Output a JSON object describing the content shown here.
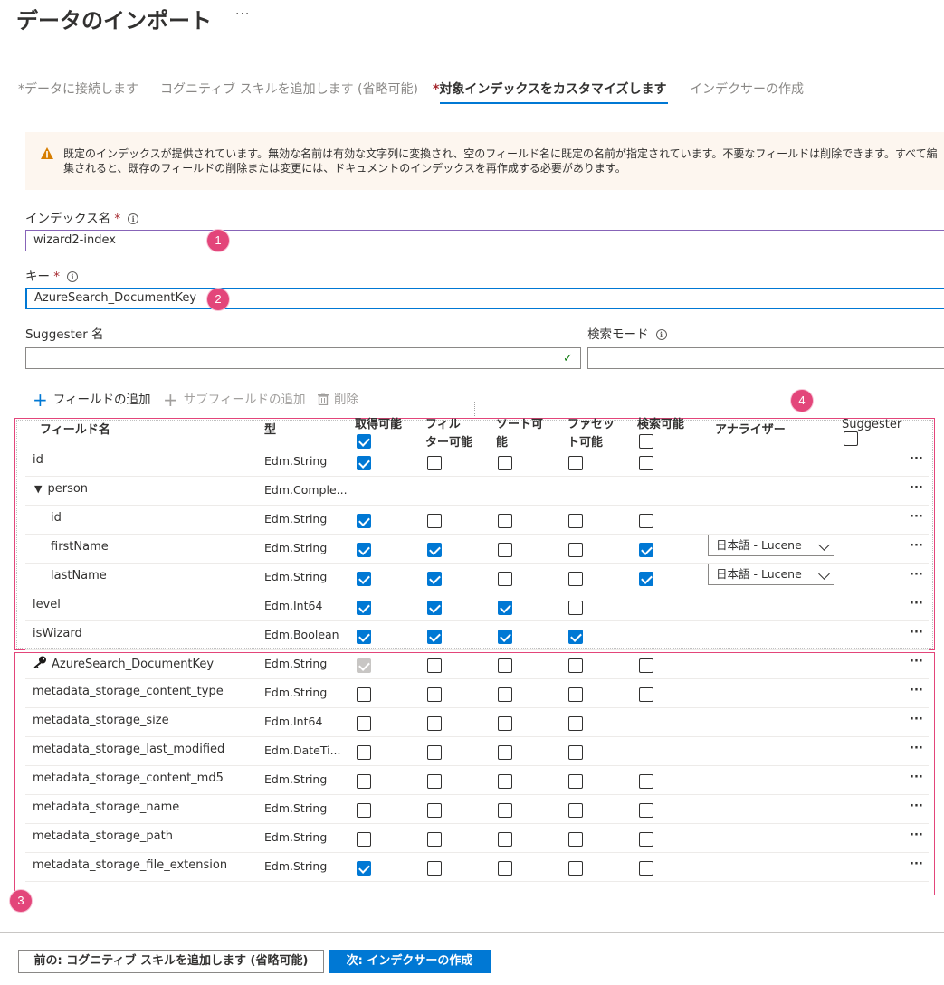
{
  "header": {
    "title": "データのインポート",
    "more_label": "···"
  },
  "steps": [
    {
      "marker": "*",
      "label": "データに接続します",
      "state": "done"
    },
    {
      "marker": "",
      "label": "コグニティブ スキルを追加します (省略可能)",
      "state": "done"
    },
    {
      "marker": "*",
      "label": "対象インデックスをカスタマイズします",
      "state": "active"
    },
    {
      "marker": "",
      "label": "インデクサーの作成",
      "state": "pending"
    }
  ],
  "warning": {
    "icon": "warning-icon",
    "text": "既定のインデックスが提供されています。無効な名前は有効な文字列に変換され、空のフィールド名に既定の名前が指定されています。不要なフィールドは削除できます。すべて編集されると、既存のフィールドの削除または変更には、ドキュメントのインデックスを再作成する必要があります。"
  },
  "form": {
    "index_name": {
      "label": "インデックス名",
      "required_mark": "*",
      "value": "wizard2-index",
      "info_icon": "i"
    },
    "key": {
      "label": "キー",
      "required_mark": "*",
      "value": "AzureSearch_DocumentKey",
      "info_icon": "i"
    },
    "suggester_name": {
      "label": "Suggester 名",
      "value": ""
    },
    "search_mode": {
      "label": "検索モード",
      "value": "",
      "info_icon": "i"
    }
  },
  "toolbar": {
    "add_field": "フィールドの追加",
    "add_subfield": "サブフィールドの追加",
    "delete": "削除"
  },
  "badges": [
    "1",
    "2",
    "3",
    "4"
  ],
  "table": {
    "headers": {
      "field_name": "フィールド名",
      "type": "型",
      "retrievable": "取得可能",
      "filterable_1": "フィル",
      "filterable_2": "ター可能",
      "sortable_1": "ソート可",
      "sortable_2": "能",
      "facetable_1": "ファセッ",
      "facetable_2": "ト可能",
      "searchable": "検索可能",
      "analyzer": "アナライザー",
      "suggester": "Suggester"
    },
    "header_checks": {
      "retrievable": true,
      "searchable": false,
      "suggester": false
    },
    "rows": [
      {
        "name": "id",
        "type": "Edm.String",
        "checks": [
          1,
          0,
          0,
          0,
          0
        ],
        "analyzer": ""
      },
      {
        "name": "person",
        "type": "Edm.Comple...",
        "checks": null,
        "analyzer": "",
        "expand": "▼"
      },
      {
        "name": "id",
        "type": "Edm.String",
        "checks": [
          1,
          0,
          0,
          0,
          0
        ],
        "analyzer": ""
      },
      {
        "name": "firstName",
        "type": "Edm.String",
        "checks": [
          1,
          1,
          0,
          0,
          1
        ],
        "analyzer": "日本語 - Lucene"
      },
      {
        "name": "lastName",
        "type": "Edm.String",
        "checks": [
          1,
          1,
          0,
          0,
          1
        ],
        "analyzer": "日本語 - Lucene"
      },
      {
        "name": "level",
        "type": "Edm.Int64",
        "checks": [
          1,
          1,
          1,
          0,
          null
        ],
        "analyzer": ""
      },
      {
        "name": "isWizard",
        "type": "Edm.Boolean",
        "checks": [
          1,
          1,
          1,
          1,
          null
        ],
        "analyzer": ""
      },
      {
        "name": "AzureSearch_DocumentKey",
        "type": "Edm.String",
        "checks": [
          2,
          0,
          0,
          0,
          0
        ],
        "analyzer": "",
        "key": true
      },
      {
        "name": "metadata_storage_content_type",
        "type": "Edm.String",
        "checks": [
          0,
          0,
          0,
          0,
          0
        ],
        "analyzer": ""
      },
      {
        "name": "metadata_storage_size",
        "type": "Edm.Int64",
        "checks": [
          0,
          0,
          0,
          0,
          null
        ],
        "analyzer": ""
      },
      {
        "name": "metadata_storage_last_modified",
        "type": "Edm.DateTi...",
        "checks": [
          0,
          0,
          0,
          0,
          null
        ],
        "analyzer": ""
      },
      {
        "name": "metadata_storage_content_md5",
        "type": "Edm.String",
        "checks": [
          0,
          0,
          0,
          0,
          0
        ],
        "analyzer": ""
      },
      {
        "name": "metadata_storage_name",
        "type": "Edm.String",
        "checks": [
          0,
          0,
          0,
          0,
          0
        ],
        "analyzer": ""
      },
      {
        "name": "metadata_storage_path",
        "type": "Edm.String",
        "checks": [
          0,
          0,
          0,
          0,
          0
        ],
        "analyzer": ""
      },
      {
        "name": "metadata_storage_file_extension",
        "type": "Edm.String",
        "checks": [
          1,
          0,
          0,
          0,
          0
        ],
        "analyzer": ""
      }
    ],
    "row_menu": "···"
  },
  "footer": {
    "prev_label": "前の: コグニティブ スキルを追加します (省略可能)",
    "next_label": "次: インデクサーの作成"
  },
  "colors": {
    "accent": "#0078d4",
    "badge": "#e3457a",
    "warning_bg": "#fdf6ef",
    "required": "#a4262c"
  }
}
